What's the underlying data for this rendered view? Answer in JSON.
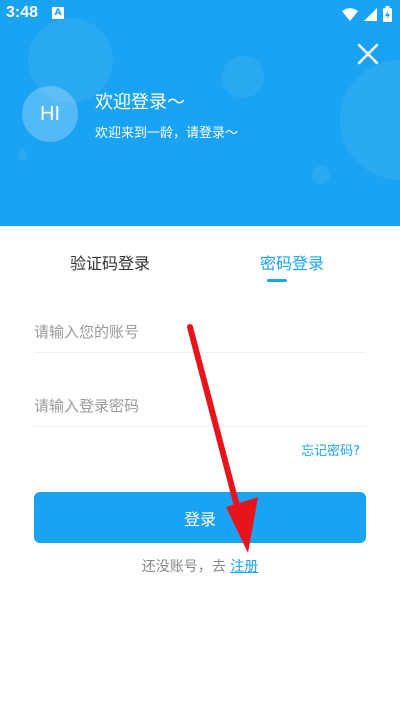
{
  "status_bar": {
    "time": "3:48",
    "app_badge": "A"
  },
  "header": {
    "avatar_text": "HI",
    "title": "欢迎登录～",
    "subtitle": "欢迎来到一龄，请登录～"
  },
  "tabs": [
    {
      "label": "验证码登录",
      "active": false
    },
    {
      "label": "密码登录",
      "active": true
    }
  ],
  "form": {
    "account_placeholder": "请输入您的账号",
    "password_placeholder": "请输入登录密码",
    "forgot_label": "忘记密码?",
    "login_label": "登录",
    "register_prompt": "还没账号，去 ",
    "register_link": "注册"
  },
  "colors": {
    "primary": "#1aa3f3",
    "annotation_arrow": "#e8141c"
  },
  "icons": [
    "wifi-icon",
    "signal-icon",
    "battery-icon",
    "close-icon",
    "red-annotation-arrow"
  ]
}
